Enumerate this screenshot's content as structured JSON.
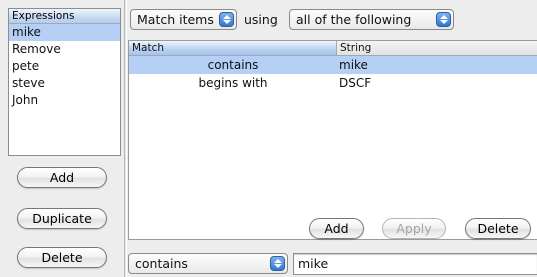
{
  "expressions": {
    "header": "Expressions",
    "items": [
      {
        "label": "mike",
        "selected": true
      },
      {
        "label": "Remove",
        "selected": false
      },
      {
        "label": "pete",
        "selected": false
      },
      {
        "label": "steve",
        "selected": false
      },
      {
        "label": "John",
        "selected": false
      }
    ],
    "buttons": {
      "add": "Add",
      "duplicate": "Duplicate",
      "delete": "Delete"
    }
  },
  "rule_bar": {
    "match_popup": "Match items",
    "using_label": "using",
    "condition_popup": "all of the following"
  },
  "table": {
    "columns": [
      "Match",
      "String"
    ],
    "rows": [
      {
        "match": "contains",
        "string": "mike",
        "selected": true
      },
      {
        "match": "begins with",
        "string": "DSCF",
        "selected": false
      }
    ]
  },
  "table_buttons": {
    "add": "Add",
    "apply": "Apply",
    "delete": "Delete"
  },
  "editor": {
    "operator_popup": "contains",
    "value": "mike"
  },
  "colors": {
    "selection": "#b5d0f4",
    "accent": "#2f78d6"
  }
}
